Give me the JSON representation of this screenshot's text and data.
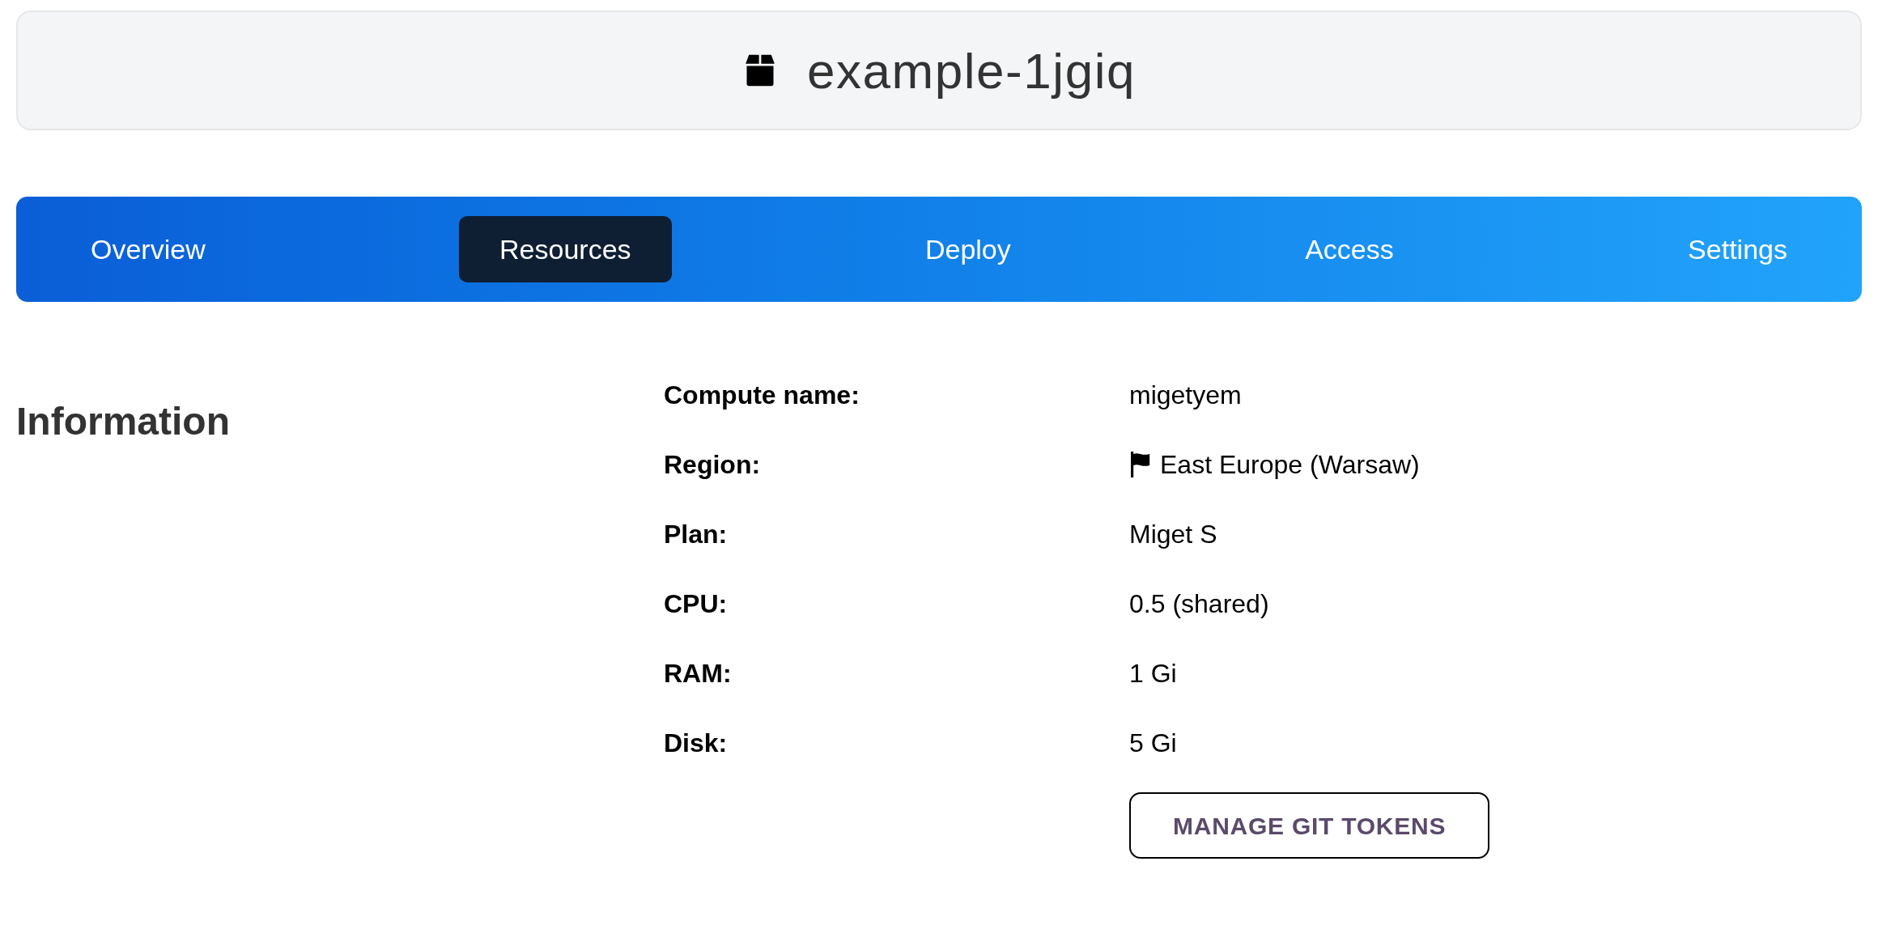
{
  "header": {
    "title": "example-1jgiq"
  },
  "tabs": [
    {
      "label": "Overview",
      "selected": false
    },
    {
      "label": "Resources",
      "selected": true
    },
    {
      "label": "Deploy",
      "selected": false
    },
    {
      "label": "Access",
      "selected": false
    },
    {
      "label": "Settings",
      "selected": false
    }
  ],
  "information": {
    "heading": "Information",
    "rows": [
      {
        "label": "Compute name:",
        "value": "migetyem",
        "kind": "text"
      },
      {
        "label": "Region:",
        "value": "East Europe (Warsaw)",
        "kind": "flag"
      },
      {
        "label": "Plan:",
        "value": "Miget S",
        "kind": "text"
      },
      {
        "label": "CPU:",
        "value": "0.5 (shared)",
        "kind": "text"
      },
      {
        "label": "RAM:",
        "value": "1 Gi",
        "kind": "text"
      },
      {
        "label": "Disk:",
        "value": "5 Gi",
        "kind": "text"
      }
    ],
    "button": "MANAGE GIT TOKENS"
  }
}
